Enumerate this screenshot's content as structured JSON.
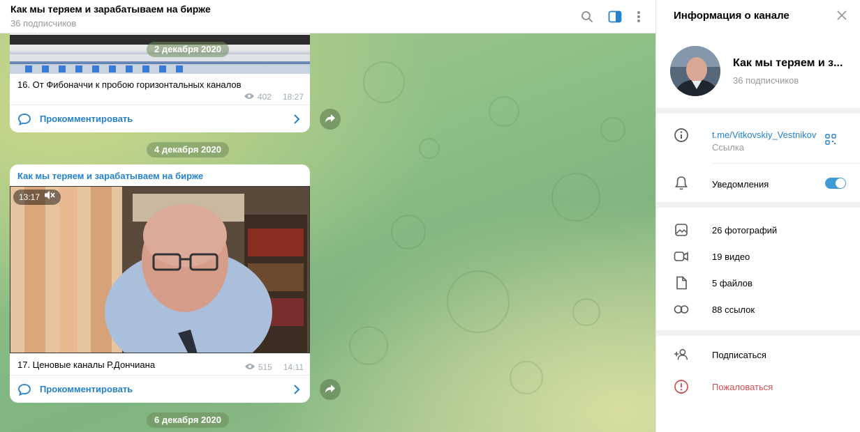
{
  "chat": {
    "title": "Как мы теряем и зарабатываем на бирже",
    "subscribers": "36 подписчиков",
    "header_icons": [
      "search-icon",
      "sidebar-toggle-icon",
      "more-vertical-icon"
    ]
  },
  "dates": [
    "2 декабря 2020",
    "4 декабря 2020",
    "6 декабря 2020"
  ],
  "posts": [
    {
      "text": "16. От Фибоначчи к пробою горизонтальных каналов",
      "views": "402",
      "time": "18:27",
      "comment_label": "Прокомментировать"
    },
    {
      "author": "Как мы теряем и зарабатываем на бирже",
      "video_duration": "13:17",
      "text": "17. Ценовые каналы Р.Дончиана",
      "views": "515",
      "time": "14:11",
      "comment_label": "Прокомментировать"
    }
  ],
  "panel": {
    "title": "Информация о канале",
    "channel_name": "Как мы теряем и з...",
    "subscribers": "36 подписчиков",
    "link": "t.me/Vitkovskiy_Vestnikov",
    "link_label": "Ссылка",
    "notifications": "Уведомления",
    "notifications_on": true,
    "media": [
      {
        "icon": "photo-icon",
        "label": "26 фотографий"
      },
      {
        "icon": "video-icon",
        "label": "19 видео"
      },
      {
        "icon": "file-icon",
        "label": "5 файлов"
      },
      {
        "icon": "link-icon",
        "label": "88 ссылок"
      }
    ],
    "subscribe": "Подписаться",
    "report": "Пожаловаться"
  },
  "colors": {
    "accent": "#2481cc",
    "toggle": "#3e9bd6",
    "danger": "#d14e4e"
  }
}
